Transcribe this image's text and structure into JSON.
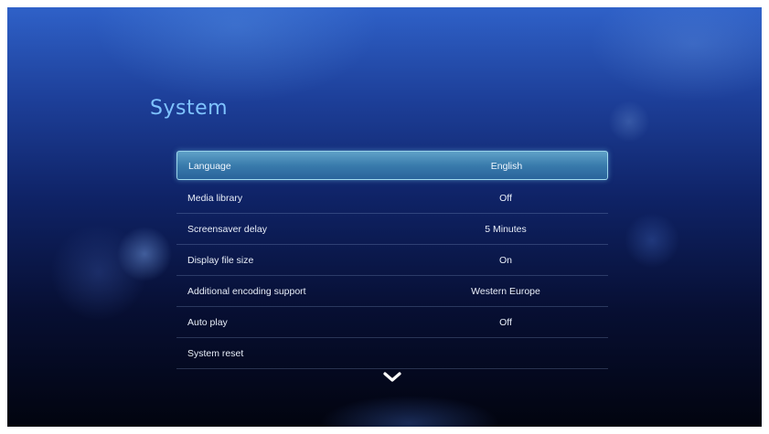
{
  "page": {
    "title": "System"
  },
  "settings": [
    {
      "label": "Language",
      "value": "English",
      "selected": true
    },
    {
      "label": "Media library",
      "value": "Off"
    },
    {
      "label": "Screensaver delay",
      "value": "5 Minutes"
    },
    {
      "label": "Display file size",
      "value": "On"
    },
    {
      "label": "Additional encoding support",
      "value": "Western Europe"
    },
    {
      "label": "Auto play",
      "value": "Off"
    },
    {
      "label": "System reset",
      "value": ""
    }
  ],
  "icons": {
    "scroll_down": "chevron-down-icon"
  },
  "colors": {
    "title": "#7fc3ff",
    "highlight": "#5fb4d8",
    "text": "#e8eef8"
  }
}
